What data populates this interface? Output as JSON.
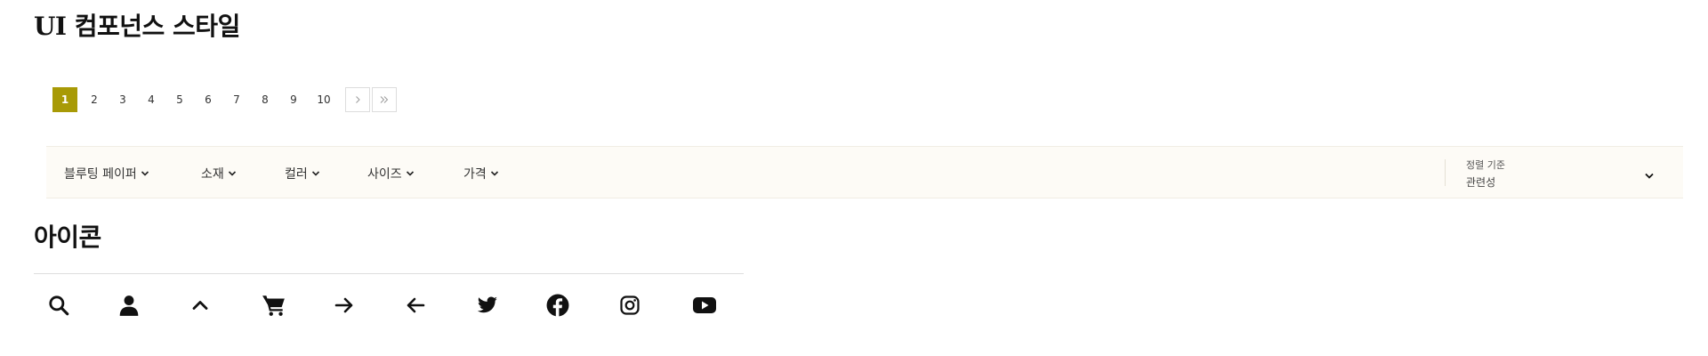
{
  "sections": {
    "ui_components_title": "UI 컴포넌스 스타일",
    "icons_title": "아이콘"
  },
  "pagination": {
    "current_page": 1,
    "pages": [
      "1",
      "2",
      "3",
      "4",
      "5",
      "6",
      "7",
      "8",
      "9",
      "10"
    ],
    "next_label": "next",
    "last_label": "last"
  },
  "filters": {
    "items": [
      {
        "label": "블루팅 페이퍼"
      },
      {
        "label": "소재"
      },
      {
        "label": "컬러"
      },
      {
        "label": "사이즈"
      },
      {
        "label": "가격"
      }
    ],
    "sort": {
      "label": "정렬 기준",
      "value": "관련성"
    }
  },
  "icons": [
    "search-icon",
    "user-icon",
    "chevron-up-icon",
    "cart-icon",
    "arrow-right-icon",
    "arrow-left-icon",
    "twitter-icon",
    "facebook-icon",
    "instagram-icon",
    "youtube-icon"
  ],
  "colors": {
    "accent": "#a89a06",
    "filter_bg": "#fdfbf6",
    "divider": "#dddddd"
  }
}
